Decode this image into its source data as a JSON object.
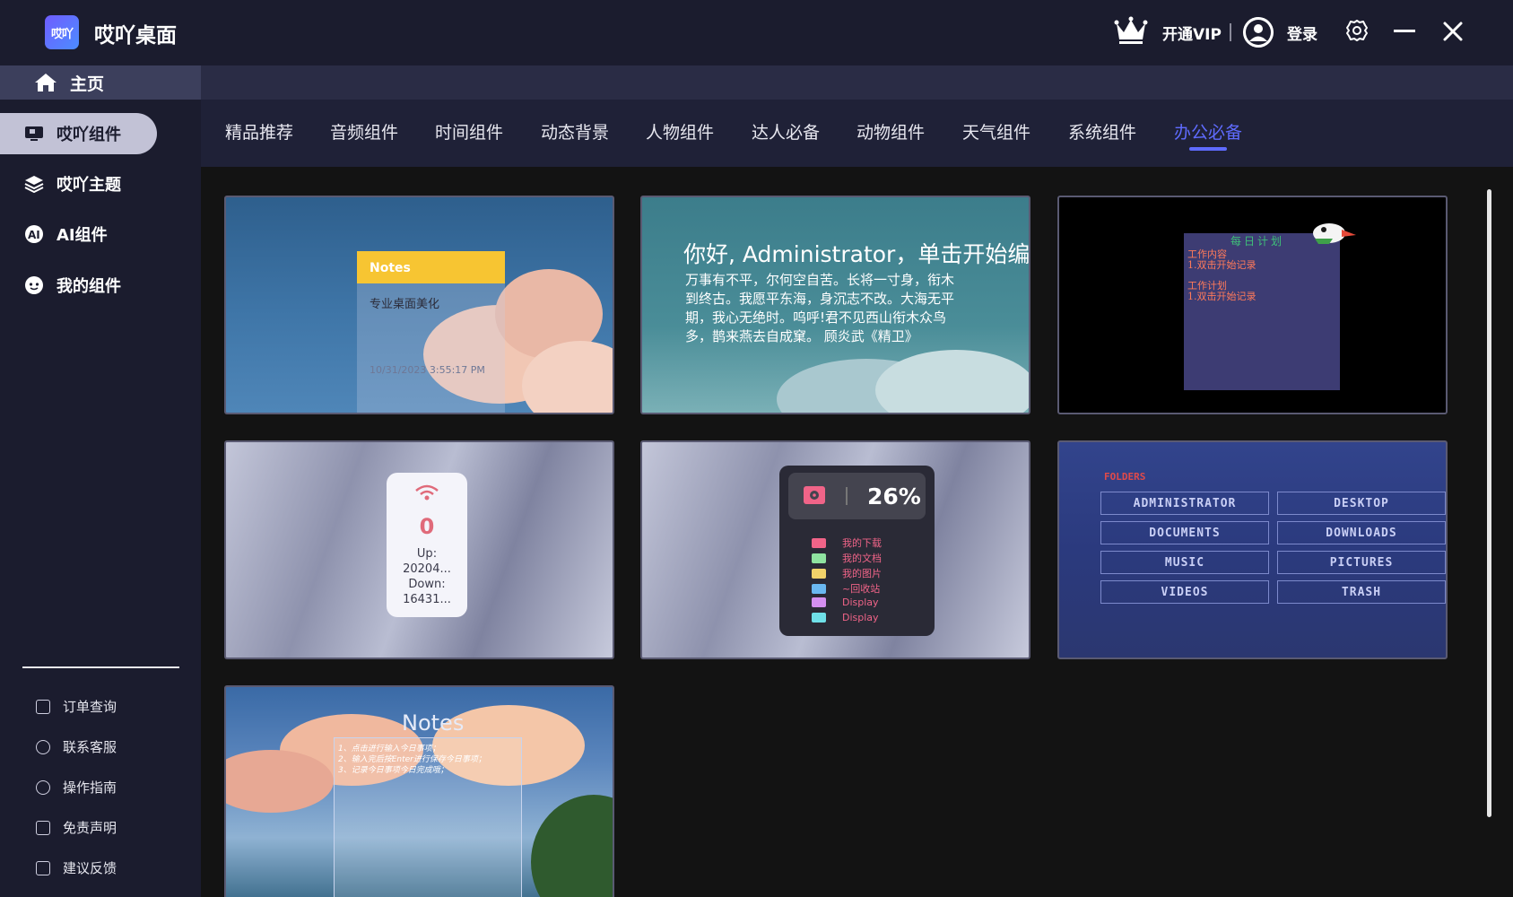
{
  "app": {
    "title": "哎吖桌面",
    "logo_text": "哎吖",
    "vip_label": "开通VIP",
    "login_label": "登录"
  },
  "home": {
    "label": "主页"
  },
  "sidebar": {
    "items": [
      {
        "label": "哎吖组件",
        "icon": "widget-icon",
        "active": true
      },
      {
        "label": "哎吖主题",
        "icon": "layers-icon",
        "active": false
      },
      {
        "label": "AI组件",
        "icon": "ai-icon",
        "active": false
      },
      {
        "label": "我的组件",
        "icon": "smile-icon",
        "active": false
      }
    ],
    "footer": [
      {
        "label": "订单查询",
        "icon": "order-icon"
      },
      {
        "label": "联系客服",
        "icon": "headset-icon"
      },
      {
        "label": "操作指南",
        "icon": "guide-icon"
      },
      {
        "label": "免责声明",
        "icon": "document-icon"
      },
      {
        "label": "建议反馈",
        "icon": "feedback-icon"
      }
    ]
  },
  "tabs": [
    {
      "label": "精品推荐"
    },
    {
      "label": "音频组件"
    },
    {
      "label": "时间组件"
    },
    {
      "label": "动态背景"
    },
    {
      "label": "人物组件"
    },
    {
      "label": "达人必备"
    },
    {
      "label": "动物组件"
    },
    {
      "label": "天气组件"
    },
    {
      "label": "系统组件"
    },
    {
      "label": "办公必备",
      "active": true
    }
  ],
  "cards": {
    "notes1": {
      "header": "Notes",
      "body": "专业桌面美化",
      "time": "10/31/2023 3:55:17 PM"
    },
    "quote": {
      "title": "你好, Administrator，单击开始编辑",
      "body": "万事有不平，尔何空自苦。长将一寸身，衔木到终古。我愿平东海，身沉志不改。大海无平期，我心无绝时。呜呼!君不见西山衔木众鸟多，鹊来燕去自成窠。 顾炎武《精卫》"
    },
    "plan": {
      "title": "每日计划",
      "lines": [
        "工作内容",
        "1.双击开始记录",
        "工作计划",
        "1.双击开始记录"
      ]
    },
    "network": {
      "value": "0",
      "lines": [
        "Up:",
        "20204...",
        "Down:",
        "16431..."
      ]
    },
    "disk": {
      "percent": "26%",
      "rows": [
        {
          "label": "我的下载",
          "color": "#f06488"
        },
        {
          "label": "我的文档",
          "color": "#8fe3a0"
        },
        {
          "label": "我的图片",
          "color": "#f1d26a"
        },
        {
          "label": "~回收站",
          "color": "#6ab8f1"
        },
        {
          "label": "Display",
          "color": "#d48ff0"
        },
        {
          "label": "Display",
          "color": "#6fe0e8"
        }
      ]
    },
    "folders": {
      "title": "FOLDERS",
      "buttons": [
        "ADMINISTRATOR",
        "DESKTOP",
        "DOCUMENTS",
        "DOWNLOADS",
        "MUSIC",
        "PICTURES",
        "VIDEOS",
        "TRASH"
      ]
    },
    "notes2": {
      "title": "Notes",
      "lines": [
        "1、点击进行输入今日事项；",
        "2、输入完后按Enter进行保存今日事项；",
        "3、记录今日事项今日完成哦；"
      ]
    }
  },
  "colors": {
    "accent": "#5f6bff",
    "titlebar": "#1b1c2e",
    "sidebar_active": "#c2c2d6"
  }
}
